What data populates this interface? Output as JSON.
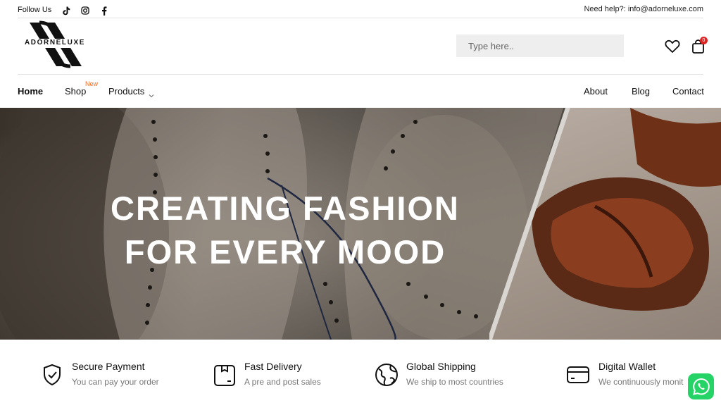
{
  "topbar": {
    "follow_label": "Follow Us",
    "socials": [
      "tiktok-icon",
      "instagram-icon",
      "facebook-icon"
    ],
    "help_text": "Need help?: info@adorneluxe.com"
  },
  "header": {
    "logo_text": "ADORNELUXE",
    "search_placeholder": "Type here..",
    "cart_count": "0"
  },
  "nav": {
    "home": "Home",
    "shop": "Shop",
    "shop_badge": "New",
    "products": "Products",
    "about": "About",
    "blog": "Blog",
    "contact": "Contact"
  },
  "hero": {
    "line1": "CREATING FASHION",
    "line2": "FOR EVERY MOOD"
  },
  "features": [
    {
      "title": "Secure Payment",
      "subtitle": "You can pay your order",
      "icon": "shield-check-icon"
    },
    {
      "title": "Fast Delivery",
      "subtitle": "A pre and post sales",
      "icon": "box-icon"
    },
    {
      "title": "Global Shipping",
      "subtitle": "We ship to most countries",
      "icon": "globe-icon"
    },
    {
      "title": "Digital Wallet",
      "subtitle": "We continuously monit",
      "icon": "wallet-icon"
    }
  ],
  "colors": {
    "accent_badge": "#f26a21",
    "cart_badge": "#e02424",
    "whatsapp": "#25d366"
  }
}
